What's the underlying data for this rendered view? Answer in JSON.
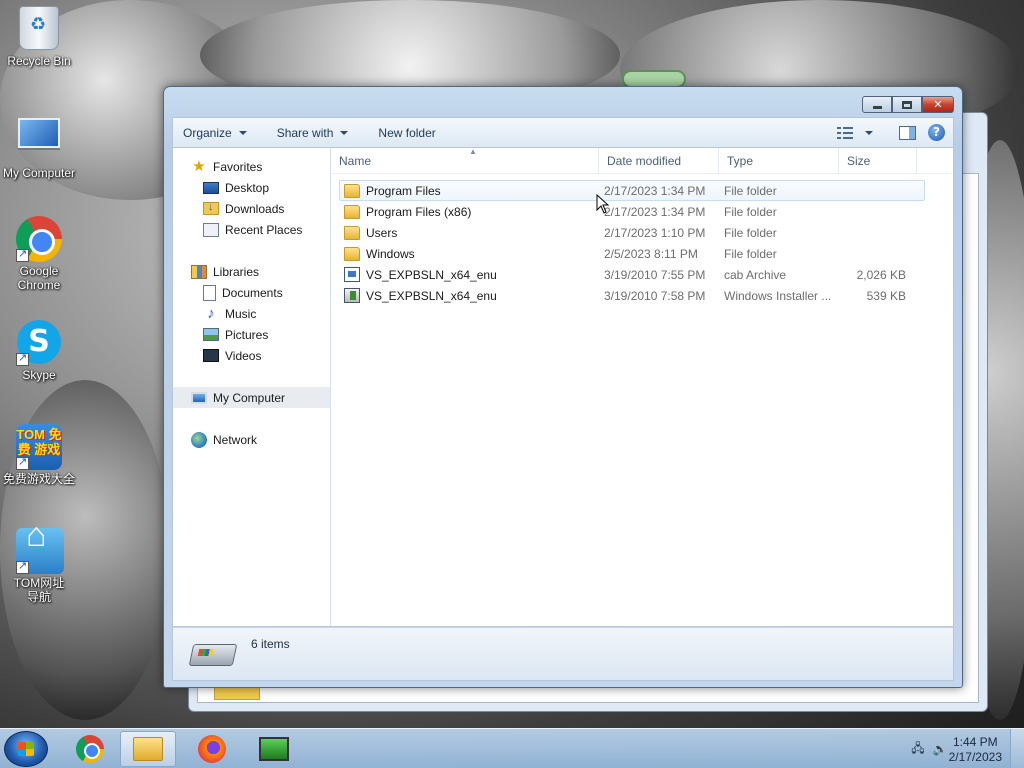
{
  "desktop": {
    "icons": [
      {
        "label": "Recycle Bin",
        "icon": "recycle-bin-icon"
      },
      {
        "label": "My Computer",
        "icon": "computer-icon"
      },
      {
        "label": "Google Chrome",
        "icon": "chrome-icon"
      },
      {
        "label": "Skype",
        "icon": "skype-icon"
      },
      {
        "label": "免费游戏大全",
        "icon": "tom-games-icon",
        "logo_text": "TOM 免费 游戏"
      },
      {
        "label": "TOM网址导航",
        "icon": "tom-nav-icon"
      }
    ]
  },
  "window": {
    "title_buttons": {
      "minimize": "minimize",
      "maximize": "maximize",
      "close": "close"
    },
    "toolbar": {
      "organize": "Organize",
      "share_with": "Share with",
      "new_folder": "New folder"
    },
    "nav": {
      "favorites": "Favorites",
      "desktop": "Desktop",
      "downloads": "Downloads",
      "recent_places": "Recent Places",
      "libraries": "Libraries",
      "documents": "Documents",
      "music": "Music",
      "pictures": "Pictures",
      "videos": "Videos",
      "my_computer": "My Computer",
      "network": "Network"
    },
    "columns": {
      "name": "Name",
      "date_modified": "Date modified",
      "type": "Type",
      "size": "Size"
    },
    "files": [
      {
        "name": "Program Files",
        "date": "2/17/2023 1:34 PM",
        "type": "File folder",
        "size": "",
        "icon": "folder-icon"
      },
      {
        "name": "Program Files (x86)",
        "date": "2/17/2023 1:34 PM",
        "type": "File folder",
        "size": "",
        "icon": "folder-icon"
      },
      {
        "name": "Users",
        "date": "2/17/2023 1:10 PM",
        "type": "File folder",
        "size": "",
        "icon": "folder-icon"
      },
      {
        "name": "Windows",
        "date": "2/5/2023 8:11 PM",
        "type": "File folder",
        "size": "",
        "icon": "folder-icon"
      },
      {
        "name": "VS_EXPBSLN_x64_enu",
        "date": "3/19/2010 7:55 PM",
        "type": "cab Archive",
        "size": "2,026 KB",
        "icon": "cab-archive-icon"
      },
      {
        "name": "VS_EXPBSLN_x64_enu",
        "date": "3/19/2010 7:58 PM",
        "type": "Windows Installer ...",
        "size": "539 KB",
        "icon": "installer-icon"
      }
    ],
    "status": {
      "item_count": "6 items"
    }
  },
  "taskbar": {
    "clock_time": "1:44 PM",
    "clock_date": "2/17/2023",
    "apps": [
      "start-button",
      "chrome",
      "windows-explorer",
      "firefox",
      "app"
    ]
  },
  "colors": {
    "window_frame": "#c8dcf0",
    "hover_row_border": "#c7dff5",
    "close_button": "#c7432d"
  }
}
